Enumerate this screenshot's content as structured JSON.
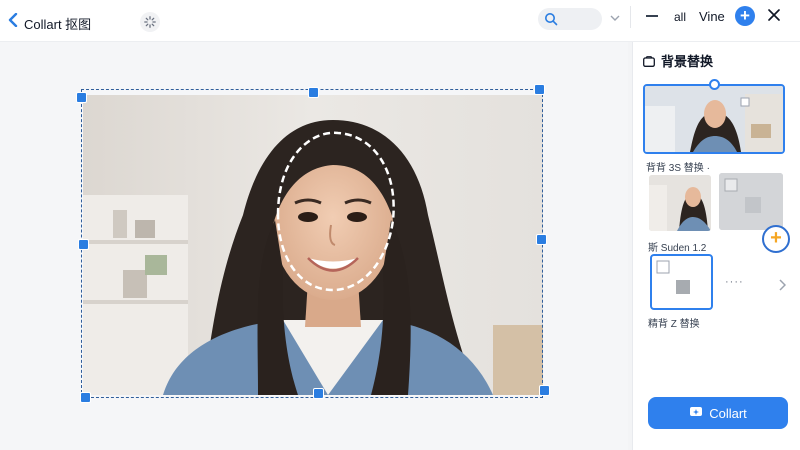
{
  "header": {
    "title": "Collart 抠图",
    "search_placeholder": "",
    "all_label": "all",
    "vine_label": "Vine"
  },
  "panel": {
    "title": "背景替换",
    "caption_1": "背背 3S 替换 ·",
    "caption_2": "斯 Suden 1.2",
    "caption_3": "精背 Z 替换",
    "more_dots": "····",
    "cta_label": "Collart"
  },
  "colors": {
    "accent": "#2f80ed",
    "selection": "#2f5e9b",
    "fab_plus": "#f5a623"
  },
  "icons": [
    "back-arrow-icon",
    "loading-spinner-icon",
    "search-icon",
    "chevron-down-icon",
    "minimize-icon",
    "add-icon",
    "close-icon",
    "image-icon",
    "add-orange-icon",
    "chevron-right-icon",
    "sparkle-icon"
  ]
}
